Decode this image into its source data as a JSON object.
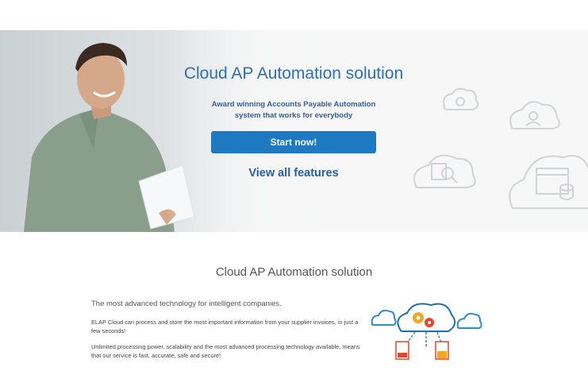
{
  "hero": {
    "title": "Cloud AP Automation solution",
    "subtitle_line1": "Award winning Accounts Payable Automation",
    "subtitle_line2": "system that works for everybody",
    "cta_label": "Start now!",
    "features_link": "View all features"
  },
  "section": {
    "title": "Cloud AP Automation solution",
    "lead": "The most advanced technology for intelligent companies.",
    "paragraph1": "ELAP Cloud can process and store the most important information from your supplier invoices, in just a few seconds!",
    "paragraph2": "Unlimited processing power, scalability and the most advanced processing technology available, means that our service is fast, accurate, safe and secure!"
  },
  "icons": [
    "gear-cloud-icon",
    "users-cloud-icon",
    "search-document-cloud-icon",
    "database-cloud-icon",
    "cloud-processing-diagram"
  ],
  "colors": {
    "brand_blue": "#1d79c1",
    "title_blue": "#2d6fb8",
    "accent_orange": "#f5a623"
  }
}
